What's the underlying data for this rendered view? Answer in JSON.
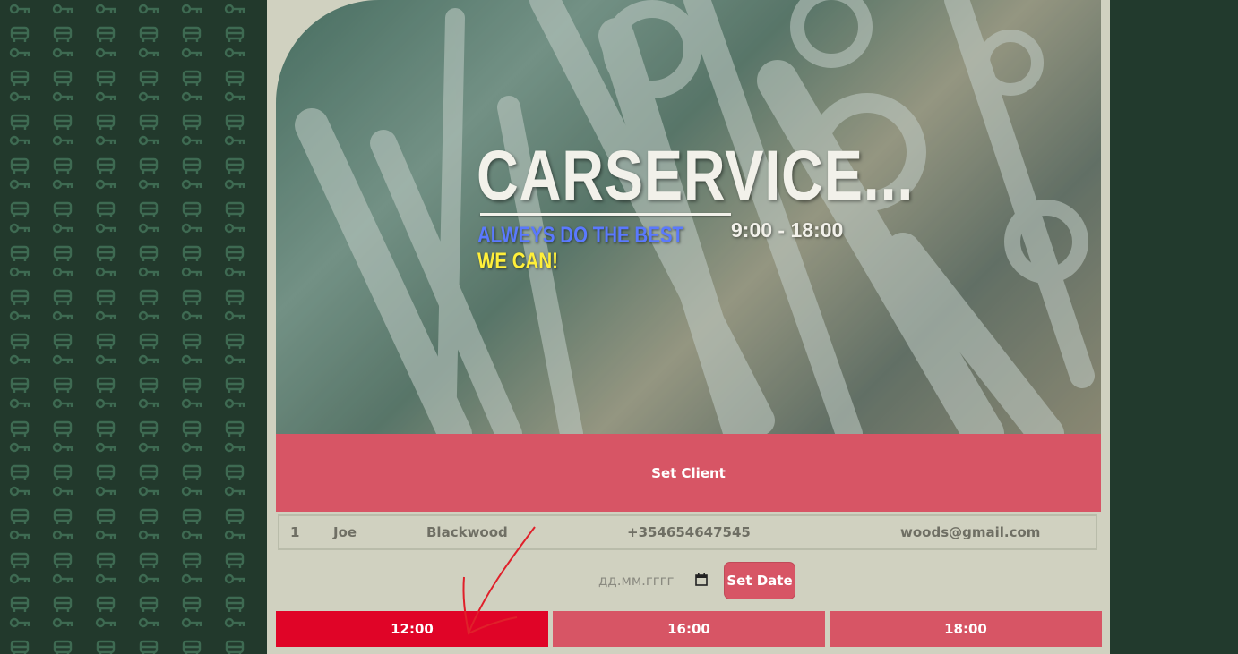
{
  "hero": {
    "title": "CARSERVICE...",
    "slogan_line1": "ALWEYS DO THE BEST",
    "slogan_line2": "WE CAN!",
    "hours": "9:00 - 18:00"
  },
  "client_form": {
    "set_client_label": "Set Client"
  },
  "client_row": {
    "id": "1",
    "first_name": "Joe",
    "last_name": "Blackwood",
    "phone": "+354654647545",
    "email": "woods@gmail.com"
  },
  "date_picker": {
    "placeholder": "дд.мм.гггг",
    "icon": "calendar-icon",
    "set_date_label": "Set Date"
  },
  "time_slots": [
    {
      "label": "12:00",
      "selected": true
    },
    {
      "label": "16:00",
      "selected": false
    },
    {
      "label": "18:00",
      "selected": false
    }
  ],
  "colors": {
    "accent": "#d75565",
    "selected_slot": "#e00427",
    "panel_bg": "#d0d1c0",
    "page_bg": "#223a2d",
    "slogan_blue": "#5a79ff",
    "slogan_yellow": "#ffef3a"
  }
}
